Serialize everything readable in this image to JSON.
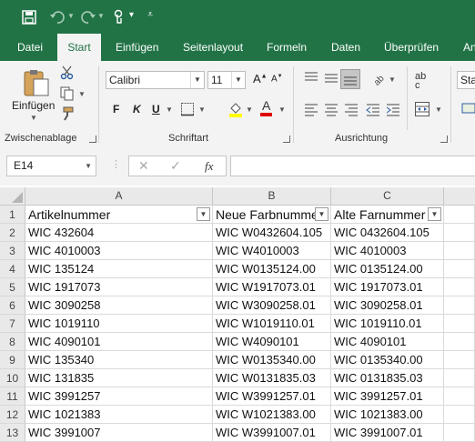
{
  "qat": {
    "more_glyph": "▾",
    "customize_glyph": "⩡"
  },
  "tabs": [
    {
      "label": "Datei"
    },
    {
      "label": "Start"
    },
    {
      "label": "Einfügen"
    },
    {
      "label": "Seitenlayout"
    },
    {
      "label": "Formeln"
    },
    {
      "label": "Daten"
    },
    {
      "label": "Überprüfen"
    },
    {
      "label": "An"
    }
  ],
  "ribbon": {
    "paste_label": "Einfügen",
    "clipboard_group": "Zwischenablage",
    "font_group": "Schriftart",
    "alignment_group": "Ausrichtung",
    "font_name": "Calibri",
    "font_size": "11",
    "bold": "F",
    "italic": "K",
    "underline": "U",
    "styles_partial": "Sta",
    "wrap_glyph": "ab c"
  },
  "formula_bar": {
    "name_box": "E14",
    "fx": "fx",
    "formula": ""
  },
  "columns": [
    "A",
    "B",
    "C"
  ],
  "rows": [
    {
      "n": "1",
      "a": "Artikelnummer",
      "b": "Neue Farbnummer",
      "c": "Alte Farnummer"
    },
    {
      "n": "2",
      "a": "WIC 432604",
      "b": "WIC W0432604.105",
      "c": "WIC 0432604.105"
    },
    {
      "n": "3",
      "a": "WIC 4010003",
      "b": "WIC W4010003",
      "c": "WIC 4010003"
    },
    {
      "n": "4",
      "a": "WIC 135124",
      "b": "WIC W0135124.00",
      "c": "WIC 0135124.00"
    },
    {
      "n": "5",
      "a": "WIC 1917073",
      "b": "WIC W1917073.01",
      "c": "WIC 1917073.01"
    },
    {
      "n": "6",
      "a": "WIC 3090258",
      "b": "WIC W3090258.01",
      "c": "WIC 3090258.01"
    },
    {
      "n": "7",
      "a": "WIC 1019110",
      "b": "WIC W1019110.01",
      "c": "WIC 1019110.01"
    },
    {
      "n": "8",
      "a": "WIC 4090101",
      "b": "WIC W4090101",
      "c": "WIC 4090101"
    },
    {
      "n": "9",
      "a": "WIC 135340",
      "b": "WIC W0135340.00",
      "c": "WIC 0135340.00"
    },
    {
      "n": "10",
      "a": "WIC 131835",
      "b": "WIC W0131835.03",
      "c": "WIC 0131835.03"
    },
    {
      "n": "11",
      "a": "WIC 3991257",
      "b": "WIC W3991257.01",
      "c": "WIC 3991257.01"
    },
    {
      "n": "12",
      "a": "WIC 1021383",
      "b": "WIC W1021383.00",
      "c": "WIC 1021383.00"
    },
    {
      "n": "13",
      "a": "WIC 3991007",
      "b": "WIC W3991007.01",
      "c": "WIC 3991007.01"
    }
  ],
  "colors": {
    "accent": "#217346",
    "ribbon_bg": "#f3f3f3",
    "font_color": "#e00000",
    "highlight": "#ffff00"
  }
}
